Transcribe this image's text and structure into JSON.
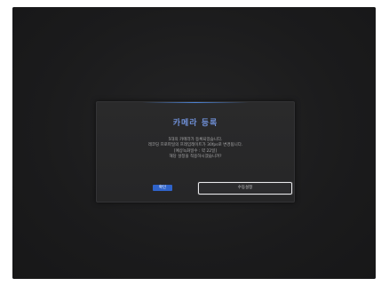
{
  "dialog": {
    "title": "카메라 등록",
    "lines": [
      "5대의 카메라가 등록되었습니다.",
      "레코딩 프로파일의 프레임레이트가 30fps로 변경됩니다.",
      "[예상녹화일수 : 약 22일]",
      "해당 설정을 적용하시겠습니까?"
    ],
    "buttons": {
      "confirm_label": "확인",
      "manual_label": "수동설정"
    }
  },
  "colors": {
    "accent": "#2f63c9",
    "title": "#6f8fd6",
    "background": "#1b1b1c"
  }
}
